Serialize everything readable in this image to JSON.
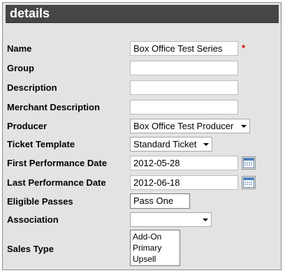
{
  "section": {
    "title": "details"
  },
  "form": {
    "name": {
      "label": "Name",
      "value": "Box Office Test Series",
      "required_marker": "*"
    },
    "group": {
      "label": "Group",
      "value": ""
    },
    "description": {
      "label": "Description",
      "value": ""
    },
    "merchant_description": {
      "label": "Merchant Description",
      "value": ""
    },
    "producer": {
      "label": "Producer",
      "selected": "Box Office Test Producer"
    },
    "ticket_template": {
      "label": "Ticket Template",
      "selected": "Standard Ticket"
    },
    "first_performance_date": {
      "label": "First Performance Date",
      "value": "2012-05-28"
    },
    "last_performance_date": {
      "label": "Last Performance Date",
      "value": "2012-06-18"
    },
    "eligible_passes": {
      "label": "Eligible Passes",
      "value": "Pass One"
    },
    "association": {
      "label": "Association",
      "selected": ""
    },
    "sales_type": {
      "label": "Sales Type",
      "options": [
        "Add-On",
        "Primary",
        "Upsell"
      ]
    }
  },
  "colors": {
    "panel_bg": "#e3e3e3",
    "header_bg": "#464646",
    "required": "#d60000"
  },
  "icons": {
    "calendar": "calendar-icon",
    "dropdown": "chevron-down-icon"
  }
}
